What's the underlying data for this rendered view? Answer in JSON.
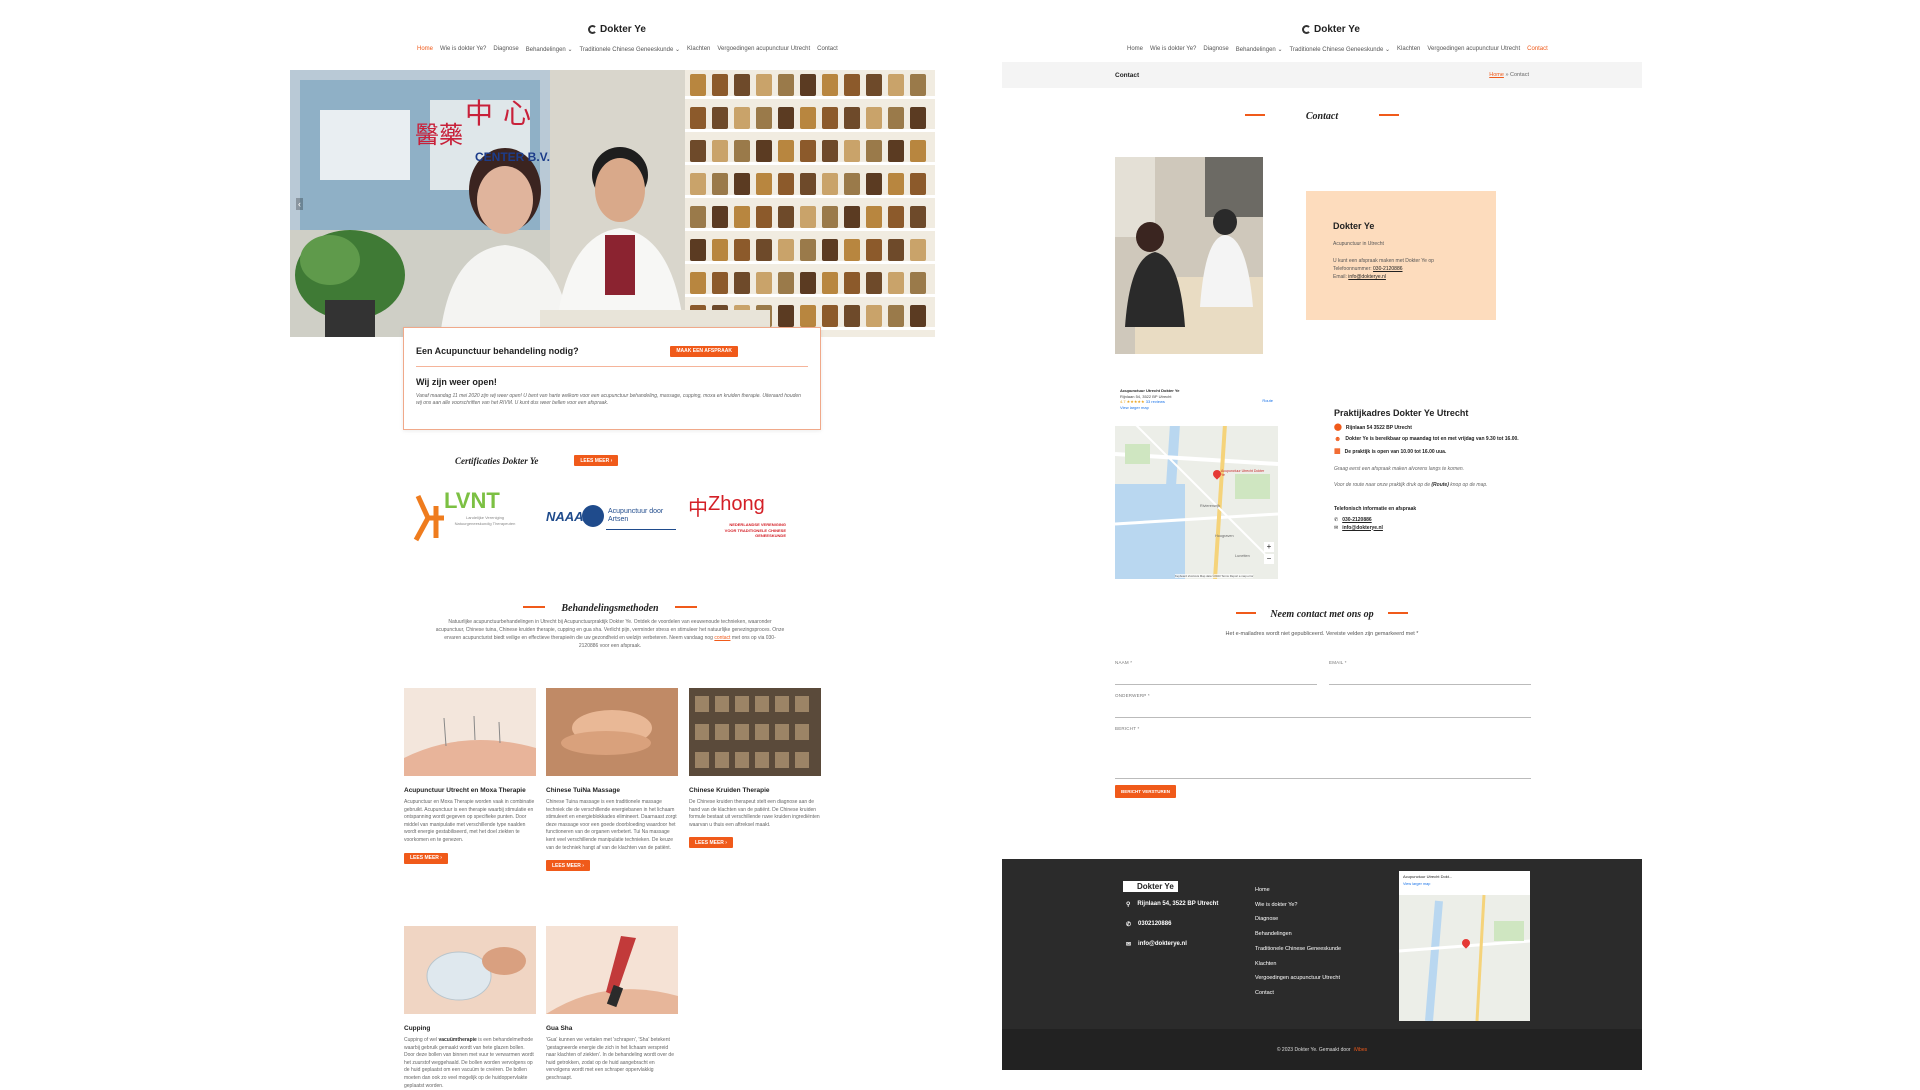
{
  "left": {
    "logo": "Dokter Ye",
    "nav": [
      "Home",
      "Wie is dokter Ye?",
      "Diagnose",
      "Behandelingen ⌄",
      "Traditionele Chinese Geneeskunde ⌄",
      "Klachten",
      "Vergoedingen acupunctuur Utrecht",
      "Contact"
    ],
    "hero_signs": {
      "sign1": "中心",
      "sign2": "醫藥",
      "sign3": "CENTER B.V."
    },
    "card": {
      "title": "Een Acupunctuur behandeling nodig?",
      "button": "MAAK EEN AFSPRAAK",
      "subtitle": "Wij zijn weer open!",
      "text": "Vanaf maandag 11 mei 2020 zijn wij weer open! U bent van harte welkom voor een acupunctuur behandeling, massage, cupping, moxa en kruiden therapie. Uiteraard houden wij ons aan alle voorschriften van het RIVM. U kunt dus weer bellen voor een afspraak."
    },
    "cert": {
      "title": "Certificaties Dokter Ye",
      "button": "LEES MEER"
    },
    "logos": {
      "lvnt": "LVNT",
      "lvnt_sub": "Landelijke Vereniging Natuurgeneeskundig Therapeuten",
      "naaa": "NAAA",
      "naaa_sub": "Acupunctuur door Artsen",
      "zhong": "Zhong",
      "zhong_sub": "NEDERLANDSE VERENIGING VOOR TRADITIONELE CHINESE GENEESKUNDE"
    },
    "methods": {
      "title": "Behandelingsmethoden",
      "intro_a": "Natuurlijke acupunctuurbehandelingen in Utrecht bij Acupunctuurpraktijk Dokter Ye. Ontdek de voordelen van eeuwenoude technieken, waaronder acupunctuur, Chinese tuina, Chinese kruiden therapie, cupping en gua sha. Verlicht pijn, verminder stress en stimuleer het natuurlijke genezingsproces. Onze ervaren acupuncturist biedt veilige en effectieve therapieën die uw gezondheid en welzijn verbeteren. Neem vandaag nog",
      "intro_link": "contact",
      "intro_b": "met ons op via 030-2120886 voor een afspraak."
    },
    "tiles": [
      {
        "title": "Acupunctuur Utrecht en Moxa Therapie",
        "text": "Acupunctuur en Moxa Therapie worden vaak in combinatie gebruikt. Acupunctuur is een therapie waarbij stimulatie en ontspanning wordt gegeven op specifieke punten. Door middel van manipulatie met verschillende type naalden wordt energie gestabiliseerd, met het doel ziekten te voorkomen en te genezen.",
        "button": "LEES MEER"
      },
      {
        "title": "Chinese TuiNa Massage",
        "text": "Chinese Tuina massage is een traditionele massage techniek die de verschillende energiebanen in het lichaam stimuleert en energieblokkades elimineert. Daarnaast zorgt deze massage voor een goede doorbloeding waardoor het functioneren van de organen verbetert. Tui Na massage kent veel verschillende manipulatie technieken. De keuze van de techniek hangt af van de klachten van de patiënt.",
        "button": "LEES MEER"
      },
      {
        "title": "Chinese Kruiden Therapie",
        "text": "De Chinese kruiden therapeut stelt een diagnose aan de hand van de klachten van de patiënt. De Chinese kruiden formule bestaat uit verschillende ruwe kruiden ingrediënten waarvan u thuis een aftreksel maakt.",
        "button": "LEES MEER"
      },
      {
        "title": "Cupping",
        "text_a": "Cupping of wel",
        "text_bold": "vacuümtherapie",
        "text_b": "is een behandelmethode waarbij gebruik gemaakt wordt van hete glazen bollen. Door deze bollen van binnen met vuur te verwarmen wordt het zuurstof weggehaald. De bollen worden vervolgens op de huid geplaatst om een vacuüm te creëren. De bollen moeten dan ook zo veel mogelijk op de huidoppervlakte geplaatst worden."
      },
      {
        "title": "Gua Sha",
        "text": "'Gua' kunnen we vertalen met 'schrapen', 'Sha' betekent 'gestagneerde energie die zich in het lichaam verspreid naar klachten of ziekten'. In de behandeling wordt over de huid getrokken, zodat op de huid aangebracht en vervolgens wordt met een schraper oppervlakkig geschraapt."
      }
    ]
  },
  "right": {
    "logo": "Dokter Ye",
    "nav": [
      "Home",
      "Wie is dokter Ye?",
      "Diagnose",
      "Behandelingen ⌄",
      "Traditionele Chinese Geneeskunde ⌄",
      "Klachten",
      "Vergoedingen acupunctuur Utrecht",
      "Contact"
    ],
    "bar": {
      "title": "Contact",
      "crumb_home": "Home",
      "crumb_sep": "»",
      "crumb_current": "Contact"
    },
    "heading": "Contact",
    "info": {
      "name": "Dokter Ye",
      "sub": "Acupunctuur in Utrecht",
      "l1": "U kunt een afspraak maken met Dokter Ye op",
      "l2_label": "Telefoonnummer:",
      "phone": "030-2120886",
      "l3_label": "Email:",
      "email": "info@dokterye.nl"
    },
    "address": {
      "title": "Praktijkadres Dokter Ye Utrecht",
      "street": "Rijnlaan 54 3522 BP Utrecht",
      "hours1": "Dokter Ye is bereikbaar op maandag tot en met vrijdag van 9.30 tot 16.00.",
      "hours2": "De praktijk is open van 10.00 tot 16.00 uua.",
      "p1": "Graag eerst een afspraak maken alvorens langs te komen.",
      "p2_a": "Voor de route naar onze praktijk druk op de",
      "p2_bold": "(Route)",
      "p2_b": "knop op de map.",
      "tel_title": "Telefonisch informatie en afspraak",
      "tel": "030-2120886",
      "mail": "info@dokterye.nl"
    },
    "map": {
      "place": "Acupunctuur Utrecht Dokter Ye",
      "addr": "Rijnlaan 54, 3522 BP Utrecht",
      "rating": "4.7 ★★★★★",
      "reviews": "33 reviews",
      "route": "Route",
      "larger": "View larger map",
      "pin": "Acupunctuur Utrecht Dokter Ye",
      "area1": "Rivierenwijk",
      "area2": "Hoograven",
      "area3": "Lunetten",
      "plus": "+",
      "minus": "−",
      "footer": "Keyboard shortcuts  Map data ©2023  Terms  Report a map error"
    },
    "form": {
      "title": "Neem contact met ons op",
      "note": "Het e-mailadres wordt niet gepubliceerd. Vereiste velden zijn gemarkeerd met *",
      "name_label": "NAAM *",
      "email_label": "EMAIL *",
      "subject_label": "ONDERWERP *",
      "message_label": "BERICHT *",
      "submit": "BERICHT VERSTUREN"
    },
    "footer": {
      "logo": "Dokter Ye",
      "address": "Rijnlaan 54, 3522 BP Utrecht",
      "phone": "0302120886",
      "email": "info@dokterye.nl",
      "links": [
        "Home",
        "Wie is dokter Ye?",
        "Diagnose",
        "Behandelingen",
        "Traditionele Chinese Geneeskunde",
        "Klachten",
        "Vergoedingen acupunctuur Utrecht",
        "Contact"
      ],
      "map_label": "Acupunctuur Utrecht Dokt...",
      "map_larger": "View larger map",
      "copyright_a": "© 2023 Dokter Ye. Gemaakt door",
      "copyright_link": "iVibes"
    }
  },
  "colors": {
    "accent": "#f05a1a",
    "peach": "#fddcbd",
    "footer_bg": "#2b2b2b"
  }
}
